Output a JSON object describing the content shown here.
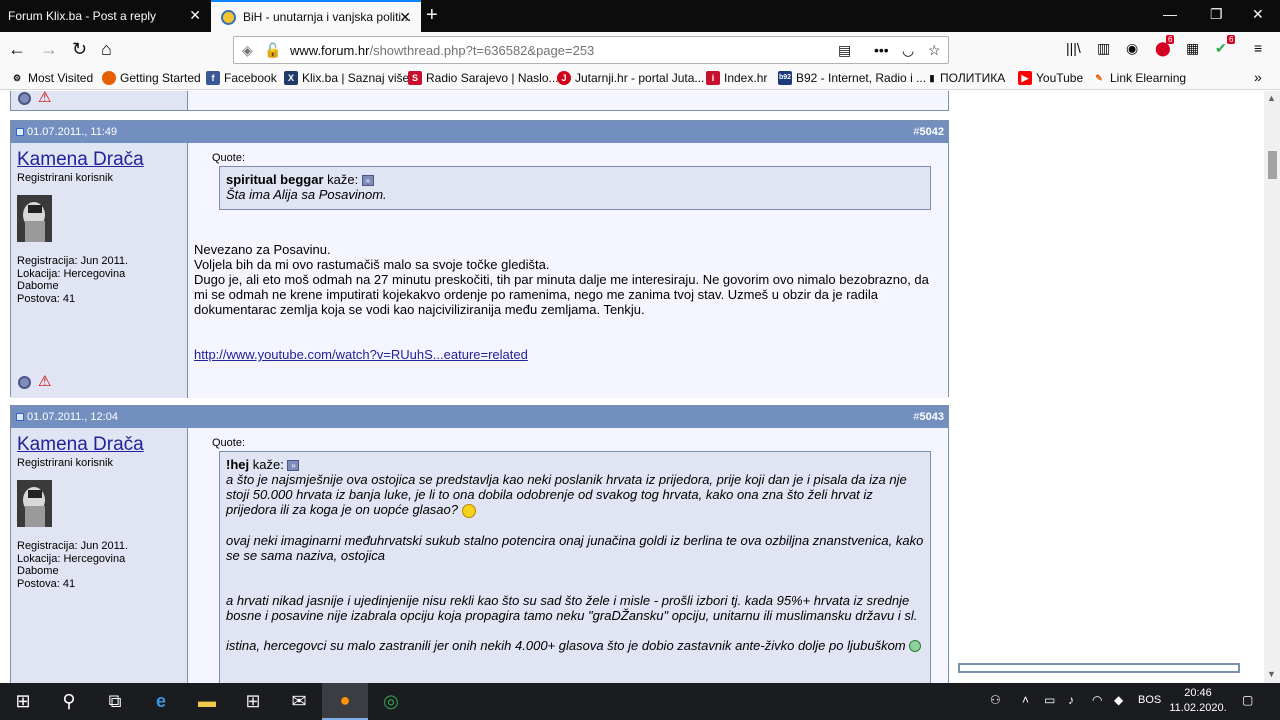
{
  "browser": {
    "tabs": [
      {
        "label": "Forum Klix.ba - Post a reply"
      },
      {
        "label": "BiH - unutarnja i vanjska politi..."
      }
    ],
    "url_prefix": "www.forum.hr",
    "url_path": "/showthread.php?t=636582&page=253",
    "badges": {
      "abp": "6",
      "shield": "6"
    },
    "bookmarks": [
      "Most Visited",
      "Getting Started",
      "Facebook",
      "Klix.ba | Saznaj više",
      "Radio Sarajevo | Naslo...",
      "Jutarnji.hr - portal Juta...",
      "Index.hr",
      "B92 - Internet, Radio i ...",
      "ПОЛИТИКА",
      "YouTube",
      "Link Elearning"
    ]
  },
  "posts": [
    {
      "date": "01.07.2011., 11:49",
      "num_prefix": "#",
      "num": "5042",
      "username": "Kamena Drača",
      "rank": "Registrirani korisnik",
      "info": [
        "Registracija: Jun 2011.",
        "Lokacija: Hercegovina",
        "Dabome",
        "Postova: 41"
      ],
      "quote_label": "Quote:",
      "quote_author": "spiritual beggar",
      "quote_says": "kaže:",
      "quote_text": [
        "Šta ima Alija sa Posavinom."
      ],
      "message": [
        "Nevezano za Posavinu.",
        "Voljela bih da mi ovo rastumačiš malo sa svoje točke gledišta.",
        "Dugo je, ali eto moš odmah na 27 minutu preskočiti, tih par minuta dalje me interesiraju. Ne govorim ovo nimalo bezobrazno, da mi se odmah ne krene imputirati kojekakvo ordenje po ramenima, nego me zanima tvoj stav. Uzmeš u obzir da je radila dokumentarac zemlja koja se vodi kao najciviliziranija među zemljama. Tenkju."
      ],
      "link": "http://www.youtube.com/watch?v=RUuhS...eature=related"
    },
    {
      "date": "01.07.2011., 12:04",
      "num_prefix": "#",
      "num": "5043",
      "username": "Kamena Drača",
      "rank": "Registrirani korisnik",
      "info": [
        "Registracija: Jun 2011.",
        "Lokacija: Hercegovina",
        "Dabome",
        "Postova: 41"
      ],
      "quote_label": "Quote:",
      "quote_author": "!hej",
      "quote_says": "kaže:",
      "quote_text": [
        "a što je najsmješnije ova ostojica se predstavlja kao neki poslanik hrvata iz prijedora, prije koji dan je i pisala da iza nje stoji 50.000 hrvata iz banja luke, je li to ona dobila odobrenje od svakog tog hrvata, kako ona zna što želi hrvat iz prijedora ili za koga je on uopće glasao?",
        "ovaj neki imaginarni međuhrvatski sukub stalno potencira onaj junačina goldi iz berlina te ova ozbiljna znanstvenica, kako se se sama naziva, ostojica",
        "a hrvati nikad jasnije i ujedinjenije nisu rekli kao što su sad što žele i misle - prošli izbori tj. kada 95%+ hrvata iz srednje bosne i posavine nije izabrala opciju koja propagira tamo neku \"graDŽansku\" opciju, unitarnu ili muslimansku državu i sl.",
        "istina, hercegovci su malo zastranili jer onih nekih 4.000+ glasova što je dobio zastavnik ante-živko dolje po ljubuškom"
      ]
    }
  ],
  "taskbar": {
    "lang": "BOS",
    "time": "20:46",
    "date": "11.02.2020."
  }
}
